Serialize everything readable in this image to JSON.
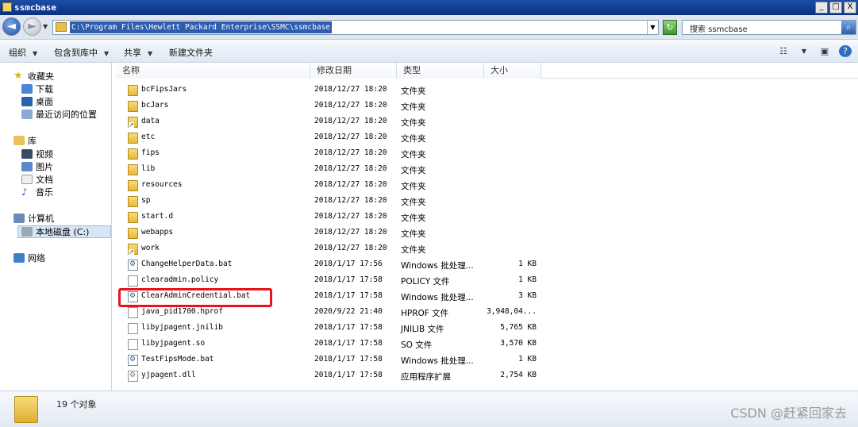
{
  "window": {
    "title": "ssmcbase",
    "min": "_",
    "max": "□",
    "close": "X"
  },
  "address": {
    "path": "C:\\Program Files\\Hewlett Packard Enterprise\\SSMC\\ssmcbase"
  },
  "search": {
    "placeholder": "搜索 ssmcbase"
  },
  "toolbar": {
    "organize": "组织",
    "include_library": "包含到库中",
    "share": "共享",
    "new_folder": "新建文件夹"
  },
  "nav": {
    "favorites": "收藏夹",
    "downloads": "下载",
    "desktop": "桌面",
    "recent": "最近访问的位置",
    "libraries": "库",
    "videos": "视频",
    "pictures": "图片",
    "documents": "文档",
    "music": "音乐",
    "computer": "计算机",
    "local_disk": "本地磁盘 (C:)",
    "network": "网络"
  },
  "columns": {
    "name": "名称",
    "date": "修改日期",
    "type": "类型",
    "size": "大小"
  },
  "files": [
    {
      "name": "bcFipsJars",
      "date": "2018/12/27 18:20",
      "type": "文件夹",
      "size": "",
      "icon": "folder"
    },
    {
      "name": "bcJars",
      "date": "2018/12/27 18:20",
      "type": "文件夹",
      "size": "",
      "icon": "folder"
    },
    {
      "name": "data",
      "date": "2018/12/27 18:20",
      "type": "文件夹",
      "size": "",
      "icon": "shortcut"
    },
    {
      "name": "etc",
      "date": "2018/12/27 18:20",
      "type": "文件夹",
      "size": "",
      "icon": "folder"
    },
    {
      "name": "fips",
      "date": "2018/12/27 18:20",
      "type": "文件夹",
      "size": "",
      "icon": "folder"
    },
    {
      "name": "lib",
      "date": "2018/12/27 18:20",
      "type": "文件夹",
      "size": "",
      "icon": "folder"
    },
    {
      "name": "resources",
      "date": "2018/12/27 18:20",
      "type": "文件夹",
      "size": "",
      "icon": "folder"
    },
    {
      "name": "sp",
      "date": "2018/12/27 18:20",
      "type": "文件夹",
      "size": "",
      "icon": "folder"
    },
    {
      "name": "start.d",
      "date": "2018/12/27 18:20",
      "type": "文件夹",
      "size": "",
      "icon": "folder"
    },
    {
      "name": "webapps",
      "date": "2018/12/27 18:20",
      "type": "文件夹",
      "size": "",
      "icon": "folder"
    },
    {
      "name": "work",
      "date": "2018/12/27 18:20",
      "type": "文件夹",
      "size": "",
      "icon": "shortcut"
    },
    {
      "name": "ChangeHelperData.bat",
      "date": "2018/1/17 17:56",
      "type": "Windows 批处理...",
      "size": "1 KB",
      "icon": "bat"
    },
    {
      "name": "clearadmin.policy",
      "date": "2018/1/17 17:58",
      "type": "POLICY 文件",
      "size": "1 KB",
      "icon": "file"
    },
    {
      "name": "ClearAdminCredential.bat",
      "date": "2018/1/17 17:58",
      "type": "Windows 批处理...",
      "size": "3 KB",
      "icon": "bat"
    },
    {
      "name": "java_pid1700.hprof",
      "date": "2020/9/22 21:40",
      "type": "HPROF 文件",
      "size": "3,948,04...",
      "icon": "file"
    },
    {
      "name": "libyjpagent.jnilib",
      "date": "2018/1/17 17:58",
      "type": "JNILIB 文件",
      "size": "5,765 KB",
      "icon": "file"
    },
    {
      "name": "libyjpagent.so",
      "date": "2018/1/17 17:58",
      "type": "SO 文件",
      "size": "3,570 KB",
      "icon": "file"
    },
    {
      "name": "TestFipsMode.bat",
      "date": "2018/1/17 17:58",
      "type": "Windows 批处理...",
      "size": "1 KB",
      "icon": "bat"
    },
    {
      "name": "yjpagent.dll",
      "date": "2018/1/17 17:58",
      "type": "应用程序扩展",
      "size": "2,754 KB",
      "icon": "dll"
    }
  ],
  "status": {
    "count": "19 个对象"
  },
  "watermark": "CSDN @赶紧回家去"
}
